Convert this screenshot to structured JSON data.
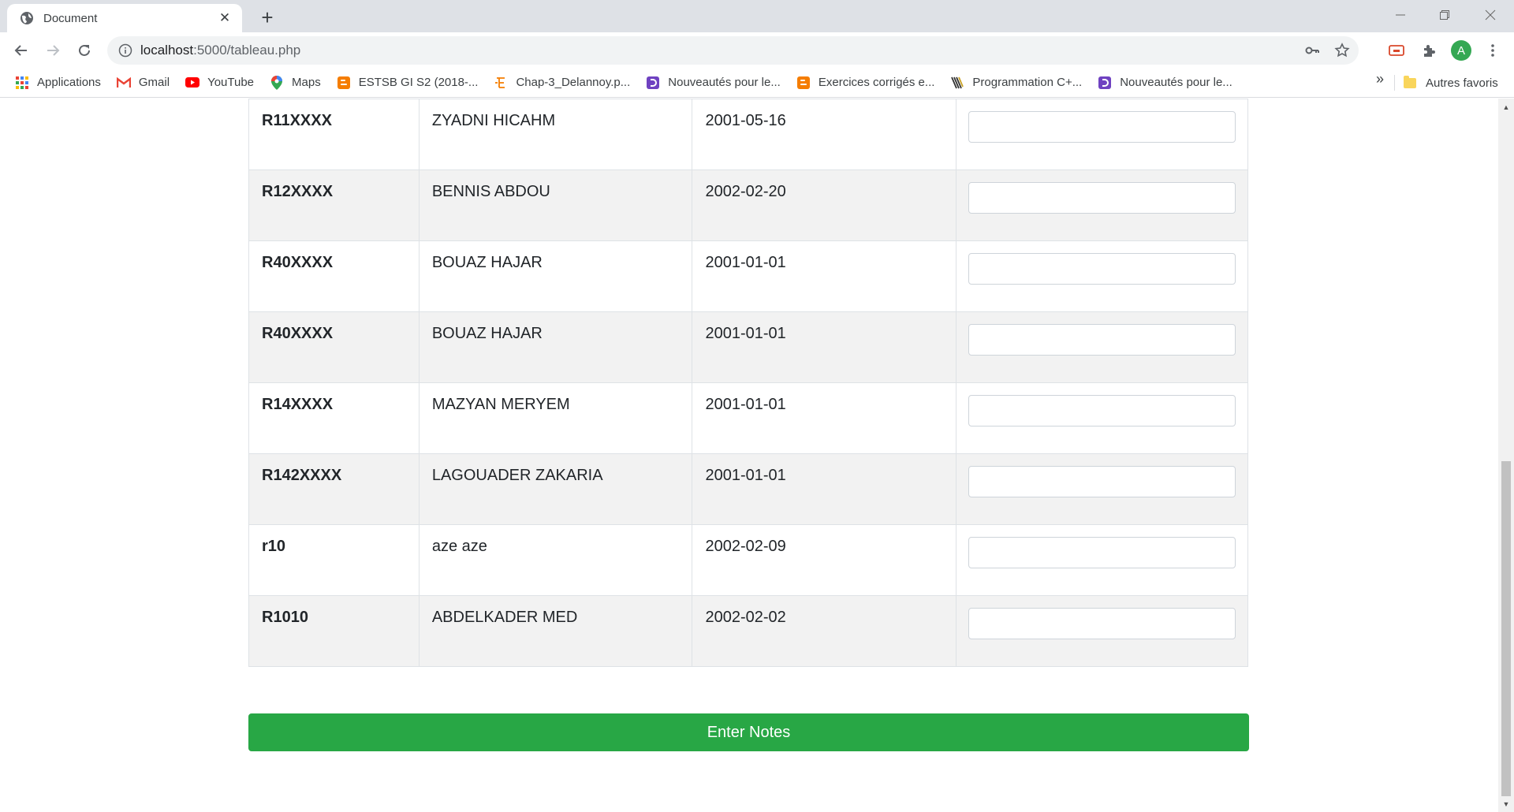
{
  "browser": {
    "tab_title": "Document",
    "url_host": "localhost",
    "url_rest": ":5000/tableau.php",
    "avatar_letter": "A"
  },
  "bookmarks": [
    {
      "label": "Applications",
      "icon": "apps-grid-icon"
    },
    {
      "label": "Gmail",
      "icon": "gmail-icon"
    },
    {
      "label": "YouTube",
      "icon": "youtube-icon"
    },
    {
      "label": "Maps",
      "icon": "maps-pin-icon"
    },
    {
      "label": "ESTSB GI S2 (2018-...",
      "icon": "blogger-icon"
    },
    {
      "label": "Chap-3_Delannoy.p...",
      "icon": "doc-e-icon"
    },
    {
      "label": "Nouveautés pour le...",
      "icon": "purple-d-icon"
    },
    {
      "label": "Exercices corrigés e...",
      "icon": "blogger-icon"
    },
    {
      "label": "Programmation C+...",
      "icon": "striped-logo-icon"
    },
    {
      "label": "Nouveautés pour le...",
      "icon": "purple-d-icon"
    }
  ],
  "bookmarks_other": "Autres favoris",
  "table": {
    "rows": [
      {
        "code": "R11XXXX",
        "name": "ZYADNI HICAHM",
        "date": "2001-05-16",
        "note": ""
      },
      {
        "code": "R12XXXX",
        "name": "BENNIS ABDOU",
        "date": "2002-02-20",
        "note": ""
      },
      {
        "code": "R40XXXX",
        "name": "BOUAZ HAJAR",
        "date": "2001-01-01",
        "note": ""
      },
      {
        "code": "R40XXXX",
        "name": "BOUAZ HAJAR",
        "date": "2001-01-01",
        "note": ""
      },
      {
        "code": "R14XXXX",
        "name": "MAZYAN MERYEM",
        "date": "2001-01-01",
        "note": ""
      },
      {
        "code": "R142XXXX",
        "name": "LAGOUADER ZAKARIA",
        "date": "2001-01-01",
        "note": ""
      },
      {
        "code": "r10",
        "name": "aze aze",
        "date": "2002-02-09",
        "note": ""
      },
      {
        "code": "R1010",
        "name": "ABDELKADER MED",
        "date": "2002-02-02",
        "note": ""
      }
    ]
  },
  "submit_label": "Enter Notes",
  "colors": {
    "submit_bg": "#28a745",
    "stripe": "#f2f2f2"
  }
}
